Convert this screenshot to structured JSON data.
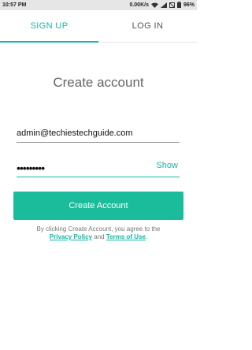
{
  "status_bar": {
    "time": "10:57 PM",
    "speed": "0.00K/s",
    "battery": "96%"
  },
  "tabs": [
    {
      "label": "SIGN UP",
      "active": true
    },
    {
      "label": "LOG IN",
      "active": false
    }
  ],
  "form": {
    "heading": "Create account",
    "email_value": "admin@techiestechguide.com",
    "password_value": "•••••••••",
    "show_label": "Show",
    "submit_label": "Create Account"
  },
  "terms": {
    "prefix": "By clicking Create Account, you agree to the",
    "privacy_label": "Privacy Policy",
    "and": "and",
    "terms_label": "Terms of Use",
    "suffix": "."
  },
  "colors": {
    "accent": "#14b8a6",
    "button": "#1abc9c"
  }
}
